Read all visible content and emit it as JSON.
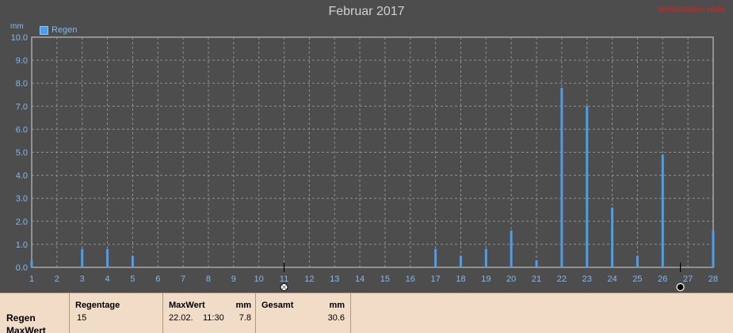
{
  "chart_data": {
    "type": "bar",
    "title": "Februar 2017",
    "ylabel": "mm",
    "ylim": [
      0,
      10
    ],
    "yticks": [
      "0.0",
      "1.0",
      "2.0",
      "3.0",
      "4.0",
      "5.0",
      "6.0",
      "7.0",
      "8.0",
      "9.0",
      "10.0"
    ],
    "x_ticks": [
      1,
      2,
      3,
      4,
      5,
      6,
      7,
      8,
      9,
      10,
      11,
      12,
      13,
      14,
      15,
      16,
      17,
      18,
      19,
      20,
      21,
      22,
      23,
      24,
      25,
      26,
      27,
      28
    ],
    "xlim": [
      1,
      28
    ],
    "grid": true,
    "legend_position": "top-left",
    "series": [
      {
        "name": "Regen",
        "color": "#4a9fe8",
        "x": [
          1,
          3,
          4,
          5,
          17,
          18,
          19,
          20,
          21,
          22,
          23,
          24,
          25,
          26,
          28
        ],
        "values": [
          0.3,
          0.8,
          0.8,
          0.5,
          0.8,
          0.5,
          0.8,
          1.6,
          0.3,
          7.8,
          7.0,
          2.6,
          0.5,
          4.9,
          1.6
        ]
      }
    ],
    "markers": [
      {
        "x": 11,
        "icon": "full-moon-icon"
      },
      {
        "x": 26.7,
        "icon": "new-moon-icon"
      }
    ]
  },
  "watermark": "Wetterstation Halle",
  "table": {
    "row_labels": [
      "Regen",
      "MaxWert"
    ],
    "regentage": {
      "header": "Regentage",
      "value": "15"
    },
    "maxwert": {
      "header": "MaxWert",
      "unit": "mm",
      "date": "22.02.",
      "time": "11:30",
      "value": "7.8"
    },
    "gesamt": {
      "header": "Gesamt",
      "unit": "mm",
      "value": "30.6"
    }
  }
}
